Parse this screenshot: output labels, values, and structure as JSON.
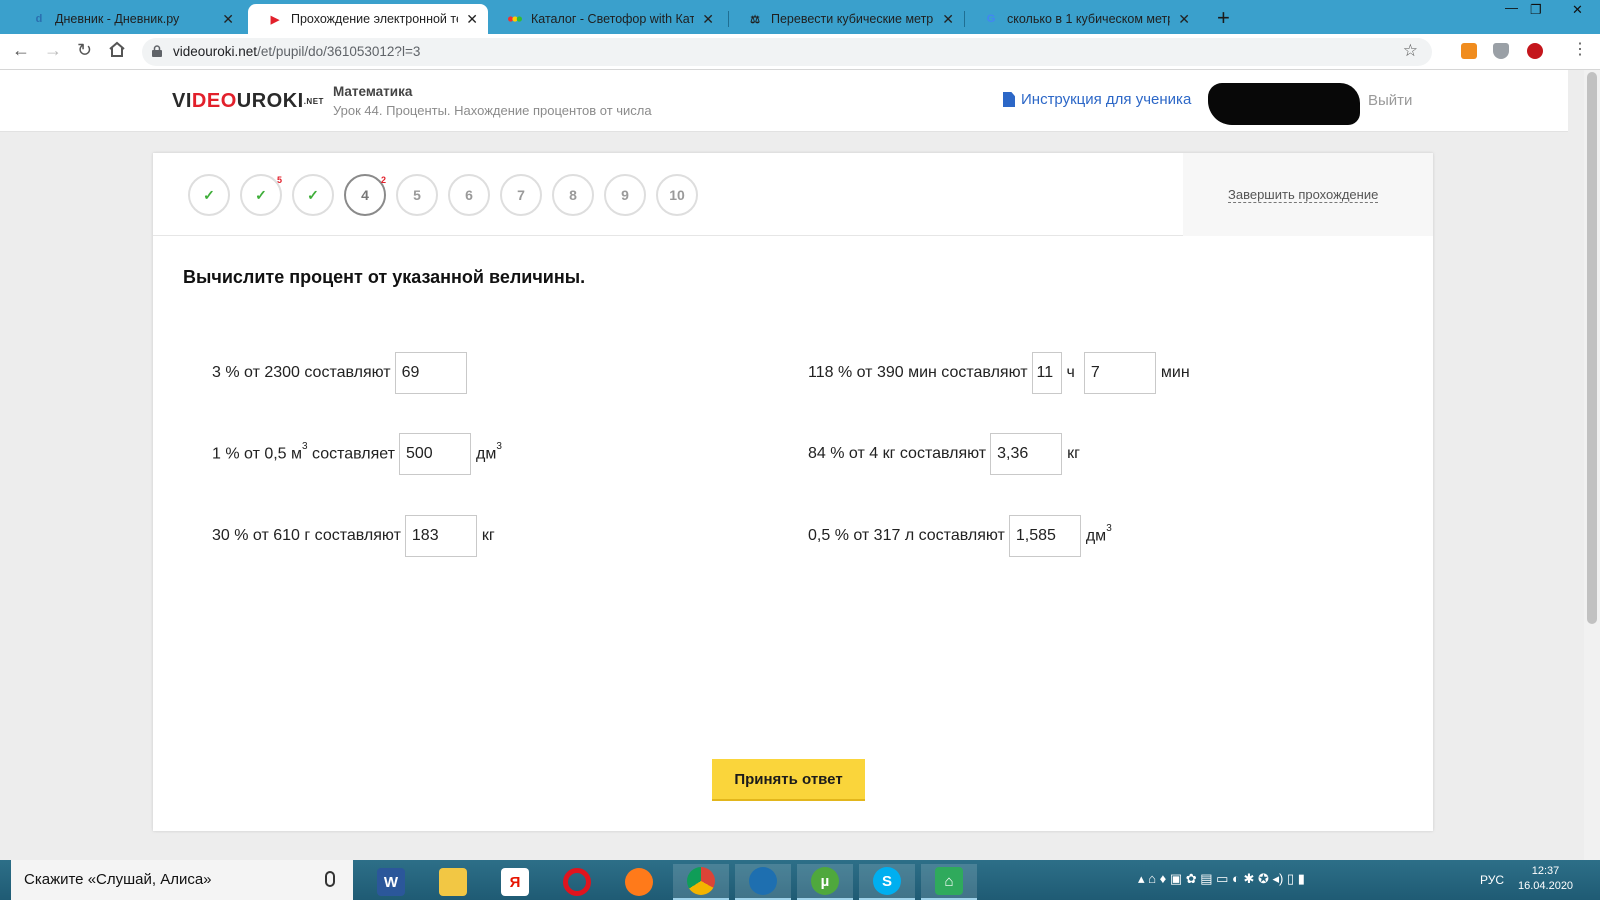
{
  "browser": {
    "tabs": [
      {
        "label": "Дневник - Дневник.ру",
        "icon": "dnevnik-icon"
      },
      {
        "label": "Прохождение электронной тетр",
        "icon": "videouroki-icon"
      },
      {
        "label": "Каталог - Светофор with Катего",
        "icon": "traffic-light-icon"
      },
      {
        "label": "Перевести кубические метры в",
        "icon": "scales-icon"
      },
      {
        "label": "сколько в 1 кубическом метре",
        "icon": "google-icon"
      }
    ],
    "close_glyph": "✕",
    "new_tab_glyph": "+",
    "url_host": "videouroki.net",
    "url_path": "/et/pupil/do/361053012?l=3"
  },
  "site": {
    "logo_part1": "VI",
    "logo_part2": "DEO",
    "logo_part3": "UROKI",
    "logo_suffix": ".NET",
    "subject": "Математика",
    "lesson": "Урок 44. Проценты. Нахождение процентов от числа",
    "instruction_link": "Инструкция для ученика",
    "logout": "Выйти"
  },
  "progress": {
    "steps": [
      {
        "label": "✓",
        "state": "done",
        "badge": ""
      },
      {
        "label": "✓",
        "state": "done",
        "badge": "5"
      },
      {
        "label": "✓",
        "state": "done",
        "badge": ""
      },
      {
        "label": "4",
        "state": "current",
        "badge": "2"
      },
      {
        "label": "5",
        "state": "pending",
        "badge": ""
      },
      {
        "label": "6",
        "state": "pending",
        "badge": ""
      },
      {
        "label": "7",
        "state": "pending",
        "badge": ""
      },
      {
        "label": "8",
        "state": "pending",
        "badge": ""
      },
      {
        "label": "9",
        "state": "pending",
        "badge": ""
      },
      {
        "label": "10",
        "state": "pending",
        "badge": ""
      }
    ],
    "finish_label": "Завершить прохождение"
  },
  "task": {
    "question": "Вычислите процент от указанной величины.",
    "items": {
      "a": {
        "text": "3 % от 2300 составляют",
        "value": "69"
      },
      "b": {
        "text_pre": "1 % от 0,5 м",
        "text_sup": "3",
        "text_post": " составляет",
        "value": "500",
        "unit": "дм",
        "unit_sup": "3"
      },
      "c": {
        "text": "30 % от 610 г составляют",
        "value": "183",
        "unit": "кг"
      },
      "d": {
        "text": "118 % от 390 мин составляют",
        "value_hours": "11",
        "unit_hours": "ч",
        "value_minutes": "7",
        "unit_minutes": "мин"
      },
      "e": {
        "text": "84 % от 4 кг составляют",
        "value": "3,36",
        "unit": "кг"
      },
      "f": {
        "text": "0,5 % от 317 л составляют",
        "value": "1,585",
        "unit": "дм",
        "unit_sup": "3"
      }
    },
    "submit_label": "Принять ответ"
  },
  "taskbar": {
    "search_placeholder": "Скажите «Слушай, Алиса»",
    "apps": [
      "word-icon",
      "file-explorer-icon",
      "yandex-browser-icon",
      "opera-icon",
      "firefox-icon",
      "chrome-icon",
      "browser-globe-icon",
      "utorrent-icon",
      "skype-icon",
      "vpn-icon"
    ],
    "language": "РУС",
    "time": "12:37",
    "date": "16.04.2020"
  },
  "colors": {
    "accent_button": "#fad53b",
    "link_blue": "#2c67c7",
    "check_green": "#3fae3a",
    "tab_strip": "#3aa0cc"
  }
}
